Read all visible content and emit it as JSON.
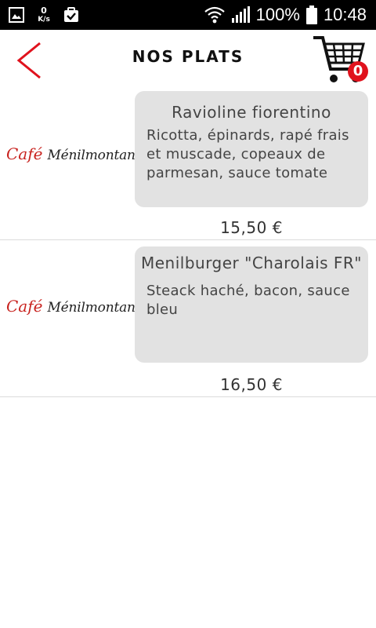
{
  "status_bar": {
    "speed_value": "0",
    "speed_unit": "K/s",
    "battery_percent": "100%",
    "time": "10:48",
    "icons": [
      "image-icon",
      "checklist-bag-icon",
      "wifi-icon",
      "signal-icon",
      "battery-icon"
    ]
  },
  "header": {
    "title": "NOS PLATS",
    "back_icon": "chevron-left-icon",
    "cart_icon": "shopping-cart-icon",
    "cart_count": "0",
    "accent_color": "#e0121d"
  },
  "brand": {
    "logo_word_1": "Café",
    "logo_word_2": "Ménilmontant"
  },
  "dishes": [
    {
      "name": "Ravioline fiorentino",
      "description": "Ricotta, épinards, rapé frais et muscade, copeaux de parmesan, sauce tomate",
      "price": "15,50 €"
    },
    {
      "name": "Menilburger \"Charolais FR\"",
      "description": "Steack haché, bacon, sauce bleu",
      "price": "16,50 €"
    }
  ]
}
